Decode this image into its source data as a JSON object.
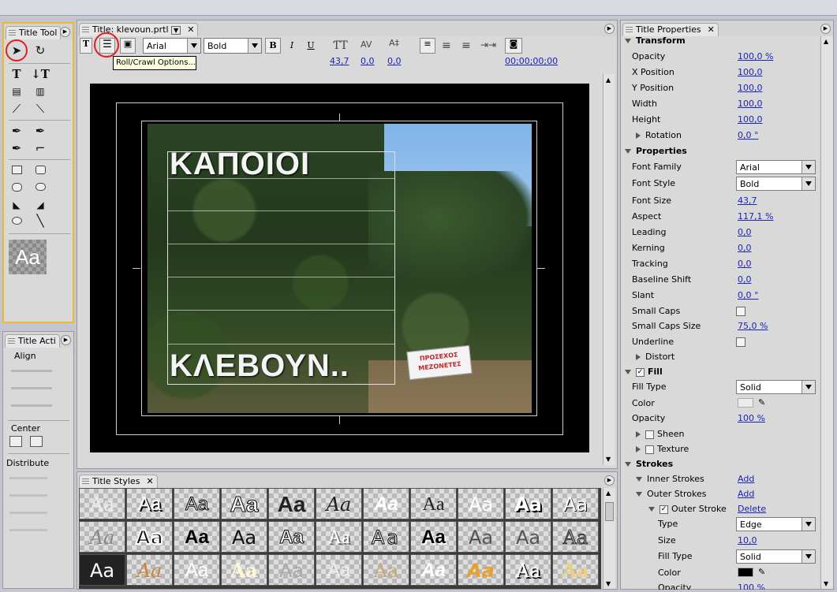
{
  "tools_panel": {
    "tab": "Title Tool"
  },
  "actions_panel": {
    "tab": "Title Acti",
    "align": "Align",
    "center": "Center",
    "distribute": "Distribute"
  },
  "title_panel": {
    "tab": "Title: klevoun.prtl",
    "font": "Arial",
    "style": "Bold",
    "bold": "B",
    "italic": "I",
    "underline": "U",
    "font_size": "43,7",
    "kerning": "0,0",
    "leading": "0,0",
    "timecode": "00;00;00;00",
    "tooltip": "Roll/Crawl Options..."
  },
  "canvas": {
    "text_top": "ΚΑΠΟΙΟΙ",
    "text_bottom": "ΚΛΕΒΟΥΝ..",
    "sign_line1": "ΠΡΟΣΕΧΟΣ",
    "sign_line2": "ΜΕΖΟΝΕΤΕΣ"
  },
  "styles_panel": {
    "tab": "Title Styles",
    "sample": "Aa"
  },
  "properties": {
    "tab": "Title Properties",
    "transform": {
      "header": "Transform",
      "rows": [
        {
          "label": "Opacity",
          "value": "100,0 %"
        },
        {
          "label": "X Position",
          "value": "100,0"
        },
        {
          "label": "Y Position",
          "value": "100,0"
        },
        {
          "label": "Width",
          "value": "100,0"
        },
        {
          "label": "Height",
          "value": "100,0"
        },
        {
          "label": "Rotation",
          "value": "0,0 °"
        }
      ]
    },
    "props": {
      "header": "Properties",
      "font_family_label": "Font Family",
      "font_family": "Arial",
      "font_style_label": "Font Style",
      "font_style": "Bold",
      "rows": [
        {
          "label": "Font Size",
          "value": "43,7"
        },
        {
          "label": "Aspect",
          "value": "117,1 %"
        },
        {
          "label": "Leading",
          "value": "0,0"
        },
        {
          "label": "Kerning",
          "value": "0,0"
        },
        {
          "label": "Tracking",
          "value": "0,0"
        },
        {
          "label": "Baseline Shift",
          "value": "0,0"
        },
        {
          "label": "Slant",
          "value": "0,0 °"
        }
      ],
      "small_caps": "Small Caps",
      "small_caps_size_label": "Small Caps Size",
      "small_caps_size": "75,0 %",
      "underline": "Underline",
      "distort": "Distort"
    },
    "fill": {
      "header": "Fill",
      "fill_type_label": "Fill Type",
      "fill_type": "Solid",
      "color_label": "Color",
      "opacity_label": "Opacity",
      "opacity": "100 %",
      "sheen": "Sheen",
      "texture": "Texture"
    },
    "strokes": {
      "header": "Strokes",
      "inner": "Inner Strokes",
      "inner_action": "Add",
      "outer": "Outer Strokes",
      "outer_action": "Add",
      "outer_stroke": "Outer Stroke",
      "outer_stroke_action": "Delete",
      "type_label": "Type",
      "type": "Edge",
      "size_label": "Size",
      "size": "10,0",
      "fill_type_label": "Fill Type",
      "fill_type": "Solid",
      "color_label": "Color",
      "opacity_label": "Opacity",
      "opacity": "100 %"
    }
  },
  "colors": {
    "accent": "#f0b830",
    "link": "#1c23b8",
    "highlight": "#e02020"
  }
}
